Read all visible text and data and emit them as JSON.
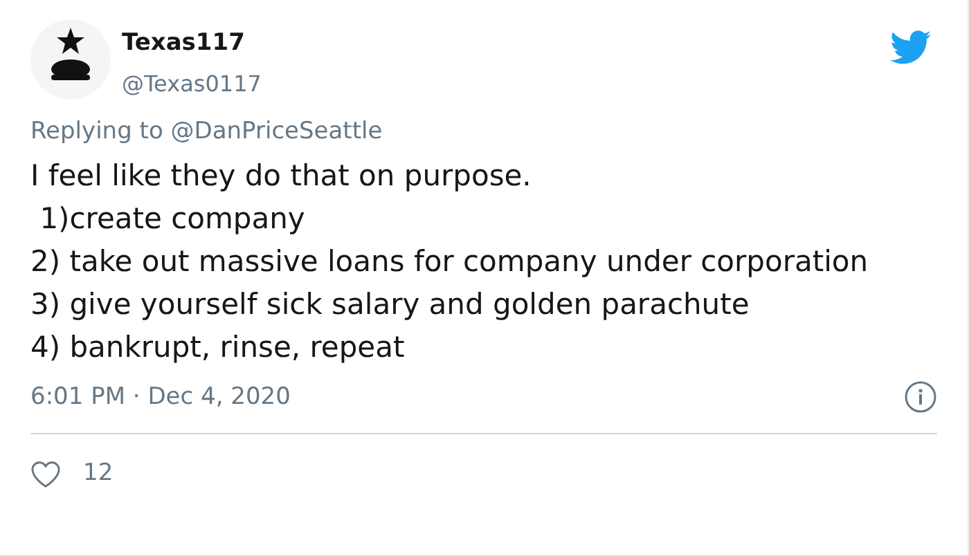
{
  "author": {
    "name": "Texas117",
    "handle": "@Texas0117"
  },
  "reply_to": "Replying to @DanPriceSeattle",
  "text": "I feel like they do that on purpose.\n 1)create company\n2) take out massive loans for company under corporation\n3) give yourself sick salary and golden parachute\n4) bankrupt, rinse, repeat",
  "timestamp": "6:01 PM · Dec 4, 2020",
  "likes": "12"
}
